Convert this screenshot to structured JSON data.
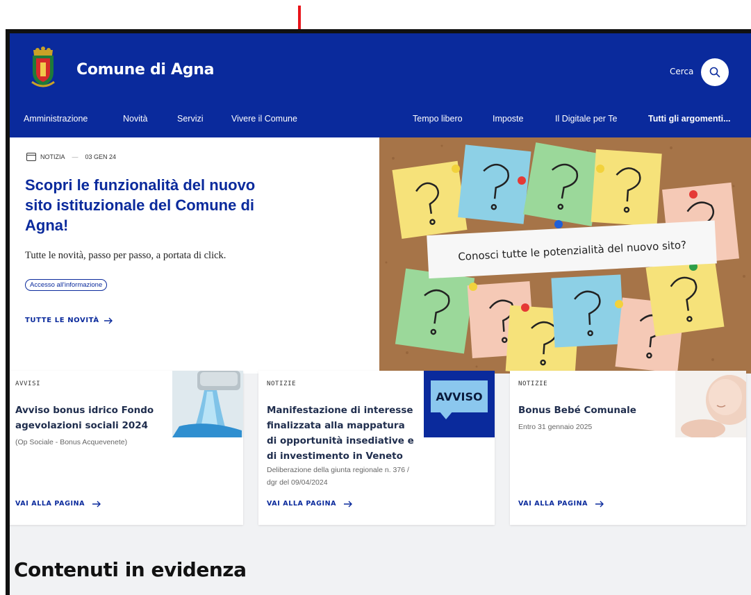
{
  "header": {
    "site_title": "Comune di Agna",
    "search_label": "Cerca",
    "brand_color": "#0a2a9c"
  },
  "nav": {
    "items": [
      {
        "label": "Amministrazione"
      },
      {
        "label": "Novità"
      },
      {
        "label": "Servizi"
      },
      {
        "label": "Vivere il Comune"
      },
      {
        "label": "Tempo libero"
      },
      {
        "label": "Imposte"
      },
      {
        "label": "Il Digitale per Te"
      },
      {
        "label": "Tutti gli argomenti..."
      }
    ]
  },
  "hero": {
    "category": "NOTIZIA",
    "date": "03 GEN 24",
    "title": "Scopri le funzionalità del nuovo sito istituzionale del Comune di Agna!",
    "subtitle": "Tutte le novità, passo per passo, a portata di click.",
    "chip": "Accesso all'informazione",
    "all_news": "TUTTE LE NOVITÀ",
    "image_caption": "Conosci tutte le potenzialità del nuovo sito?"
  },
  "cards": [
    {
      "category": "AVVISI",
      "title": "Avviso bonus idrico Fondo agevolazioni sociali 2024",
      "description": "(Op Sociale - Bonus Acquevenete)",
      "link": "VAI ALLA PAGINA"
    },
    {
      "category": "NOTIZIE",
      "title": "Manifestazione di interesse finalizzata alla mappatura di opportunità insediative e di investimento in Veneto",
      "description": "Deliberazione della giunta regionale n. 376 / dgr del 09/04/2024",
      "link": "VAI ALLA PAGINA",
      "badge": "AVVISO"
    },
    {
      "category": "NOTIZIE",
      "title": "Bonus Bebé Comunale",
      "description": "Entro 31 gennaio 2025",
      "link": "VAI ALLA PAGINA"
    }
  ],
  "section": {
    "title": "Contenuti in evidenza"
  }
}
